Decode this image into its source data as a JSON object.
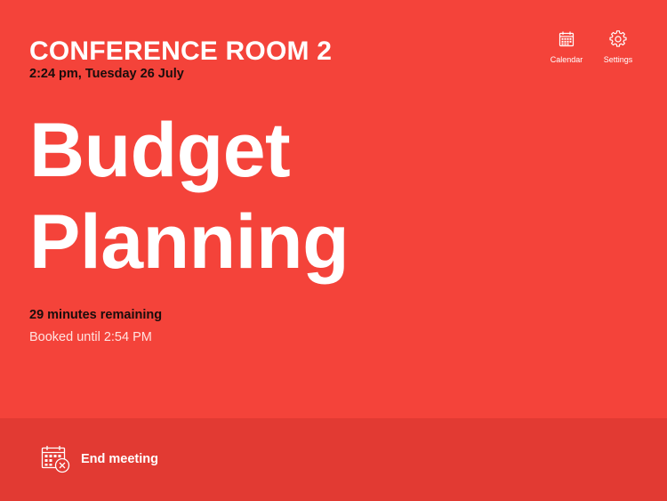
{
  "header": {
    "room_name": "CONFERENCE ROOM 2",
    "datetime": "2:24 pm, Tuesday 26 July"
  },
  "toolbar": {
    "calendar": {
      "label": "Calendar",
      "icon": "calendar-icon"
    },
    "settings": {
      "label": "Settings",
      "icon": "gear-icon"
    }
  },
  "meeting": {
    "title_lines": [
      "Budget",
      "Planning"
    ],
    "remaining": "29 minutes remaining",
    "booked_until": "Booked until 2:54 PM"
  },
  "footer": {
    "end_meeting_label": "End meeting",
    "end_meeting_icon": "calendar-cancel-icon"
  },
  "colors": {
    "background": "#f4433a",
    "footer_background": "#e23a33",
    "text_primary": "#ffffff",
    "text_dark": "#1a0d0c"
  }
}
